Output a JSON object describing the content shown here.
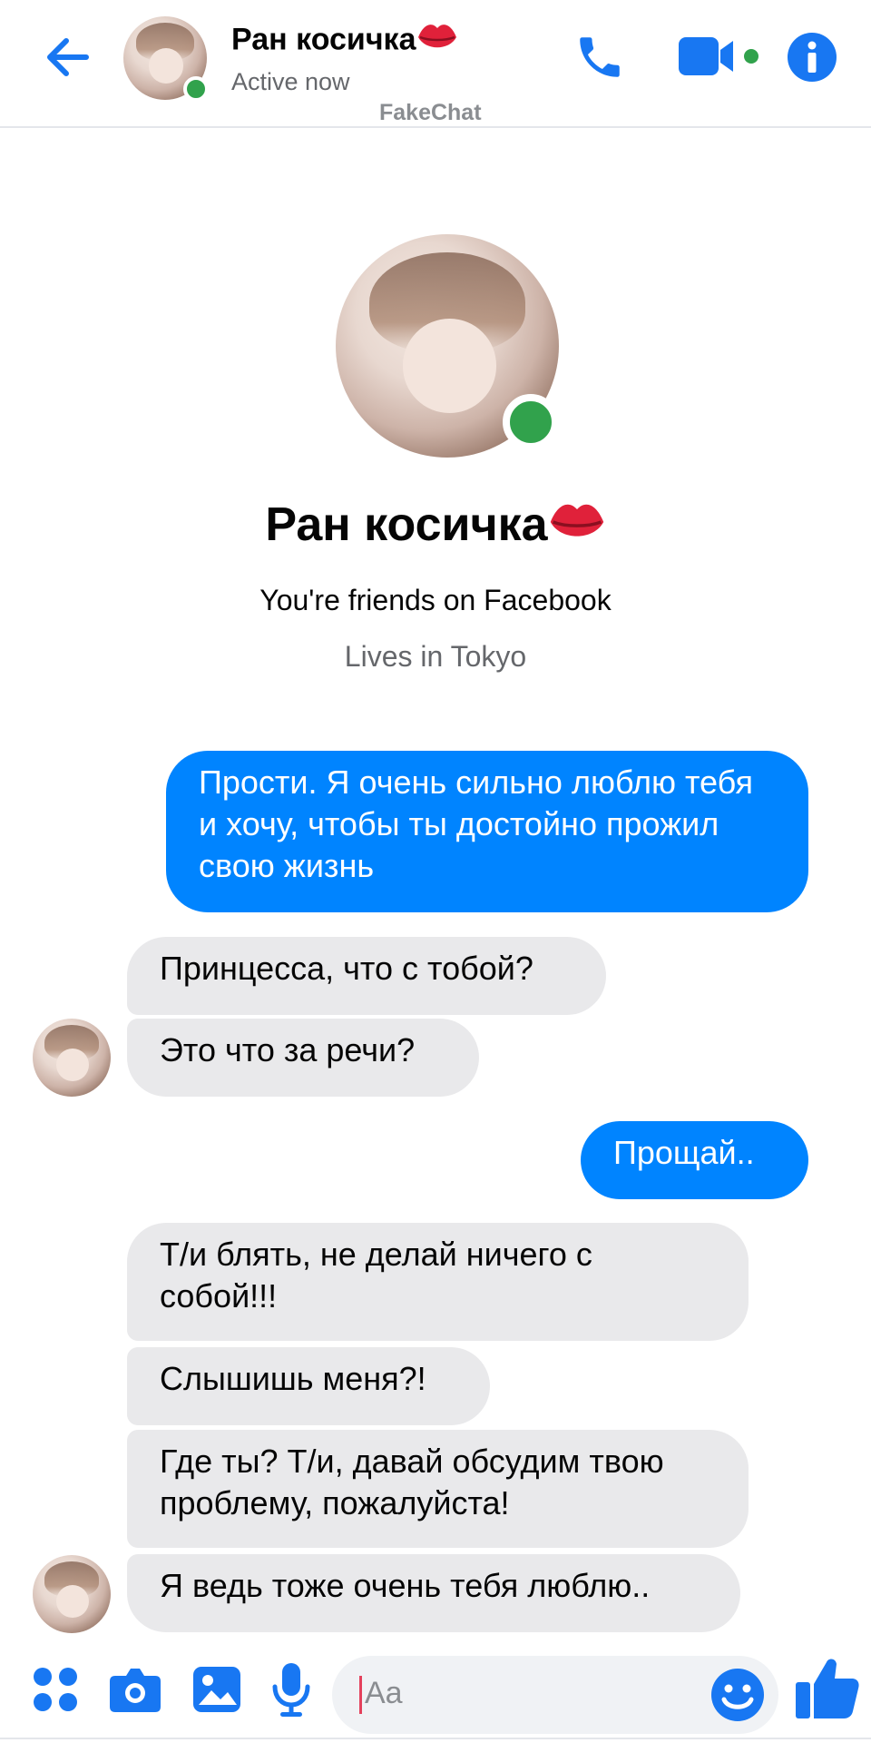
{
  "header": {
    "contact_name": "Ран косичка",
    "status": "Active now",
    "watermark": "FakeChat"
  },
  "profile": {
    "name": "Ран косичка",
    "friends_text": "You're friends on Facebook",
    "lives_text": "Lives in Tokyo"
  },
  "messages": [
    {
      "direction": "outgoing",
      "text": "Прости. Я очень сильно люблю тебя и хочу, чтобы ты достойно прожил свою жизнь"
    },
    {
      "direction": "incoming",
      "text": "Принцесса, что с тобой?"
    },
    {
      "direction": "incoming",
      "text": "Это что за речи?"
    },
    {
      "direction": "outgoing",
      "text": "Прощай.."
    },
    {
      "direction": "incoming",
      "text": "Т/и блять, не делай ничего с собой!!!"
    },
    {
      "direction": "incoming",
      "text": "Слышишь меня?!"
    },
    {
      "direction": "incoming",
      "text": "Где ты? Т/и, давай обсудим твою проблему, пожалуйста!"
    },
    {
      "direction": "incoming",
      "text": "Я ведь тоже очень тебя люблю.."
    }
  ],
  "composer": {
    "placeholder": "Aa"
  },
  "colors": {
    "accent": "#0084ff",
    "icon_blue": "#1877f2",
    "online": "#31a24c",
    "incoming_bubble": "#e9e9eb",
    "lips": "#e0213a"
  }
}
